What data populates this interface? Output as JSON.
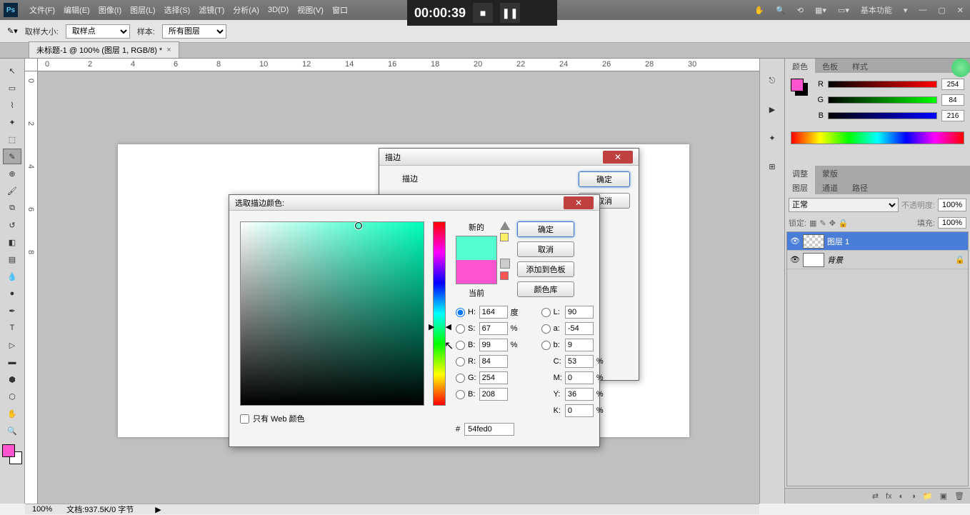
{
  "menu": {
    "items": [
      "文件(F)",
      "编辑(E)",
      "图像(I)",
      "图层(L)",
      "选择(S)",
      "滤镜(T)",
      "分析(A)",
      "3D(D)",
      "视图(V)",
      "窗口"
    ],
    "workspace": "基本功能"
  },
  "options": {
    "sample_size_label": "取样大小:",
    "sample_size_value": "取样点",
    "sample_label": "样本:",
    "sample_value": "所有图层"
  },
  "doc_tab": "未标题-1 @ 100% (图层 1, RGB/8) *",
  "video": {
    "time": "00:00:39"
  },
  "ruler_h": [
    "0",
    "2",
    "4",
    "6",
    "8",
    "10",
    "12",
    "14",
    "16",
    "18",
    "20",
    "22",
    "24",
    "26",
    "28",
    "30"
  ],
  "ruler_v": [
    "0",
    "2",
    "4",
    "6",
    "8"
  ],
  "status": {
    "zoom": "100%",
    "doc": "文档:937.5K/0 字节"
  },
  "stroke_dialog": {
    "title": "描边",
    "section": "描边",
    "ok": "确定",
    "cancel": "取消"
  },
  "color_picker": {
    "title": "选取描边颜色:",
    "new_label": "新的",
    "current_label": "当前",
    "ok": "确定",
    "cancel": "取消",
    "add_swatch": "添加到色板",
    "library": "颜色库",
    "web_only": "只有 Web 颜色",
    "hex_label": "#",
    "hex": "54fed0",
    "H": "164",
    "H_unit": "度",
    "S": "67",
    "S_unit": "%",
    "Bv": "99",
    "Bv_unit": "%",
    "L": "90",
    "a": "-54",
    "bb": "9",
    "R": "84",
    "G": "254",
    "Bc": "208",
    "C": "53",
    "C_unit": "%",
    "M": "0",
    "M_unit": "%",
    "Y": "36",
    "Y_unit": "%",
    "K": "0",
    "K_unit": "%",
    "lbl_H": "H:",
    "lbl_S": "S:",
    "lbl_Bv": "B:",
    "lbl_L": "L:",
    "lbl_a": "a:",
    "lbl_bb": "b:",
    "lbl_R": "R:",
    "lbl_G": "G:",
    "lbl_Bc": "B:",
    "lbl_C": "C:",
    "lbl_M": "M:",
    "lbl_Y": "Y:",
    "lbl_K": "K:"
  },
  "right_panel": {
    "tabs1": [
      "颜色",
      "色板",
      "样式"
    ],
    "r": "254",
    "g": "84",
    "b": "216",
    "tabs2": [
      "调整",
      "蒙版"
    ],
    "tabs3": [
      "图层",
      "通道",
      "路径"
    ],
    "blend": "正常",
    "opacity_label": "不透明度:",
    "opacity": "100%",
    "lock_label": "锁定:",
    "fill_label": "填充:",
    "fill": "100%",
    "layers": [
      {
        "name": "图层 1",
        "selected": true,
        "locked": false
      },
      {
        "name": "背景",
        "selected": false,
        "locked": true
      }
    ]
  }
}
